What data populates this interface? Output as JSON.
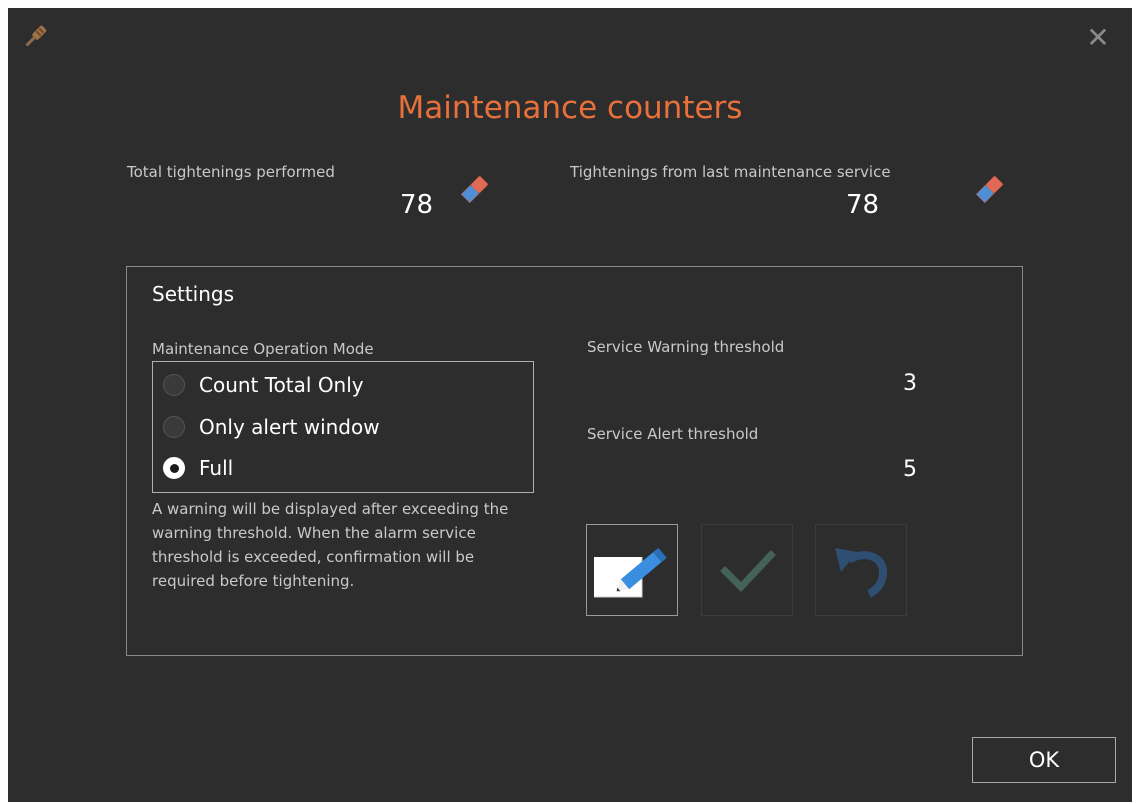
{
  "window": {
    "close_icon": "close-icon",
    "app_icon": "screwdriver-icon"
  },
  "title": "Maintenance counters",
  "counters": {
    "total": {
      "label": "Total tightenings performed",
      "value": "78",
      "reset_icon": "eraser-icon"
    },
    "since_service": {
      "label": "Tightenings from last maintenance service",
      "value": "78",
      "reset_icon": "eraser-icon"
    }
  },
  "settings": {
    "title": "Settings",
    "mode_label": "Maintenance Operation Mode",
    "modes": [
      {
        "label": "Count Total Only",
        "checked": false
      },
      {
        "label": "Only alert window",
        "checked": false
      },
      {
        "label": "Full",
        "checked": true
      }
    ],
    "help_text": "A warning will be displayed after exceeding the warning threshold. When the alarm service threshold is exceeded, confirmation will be required before tightening.",
    "warning_threshold": {
      "label": "Service Warning threshold",
      "value": "3"
    },
    "alert_threshold": {
      "label": "Service Alert threshold",
      "value": "5"
    },
    "actions": {
      "edit_icon": "edit-pencil-icon",
      "confirm_icon": "checkmark-icon",
      "undo_icon": "undo-icon"
    }
  },
  "footer": {
    "ok_label": "OK"
  },
  "colors": {
    "background": "#2d2d2d",
    "accent": "#e8703a",
    "text": "#ffffff",
    "muted_text": "#c9c9c9"
  }
}
